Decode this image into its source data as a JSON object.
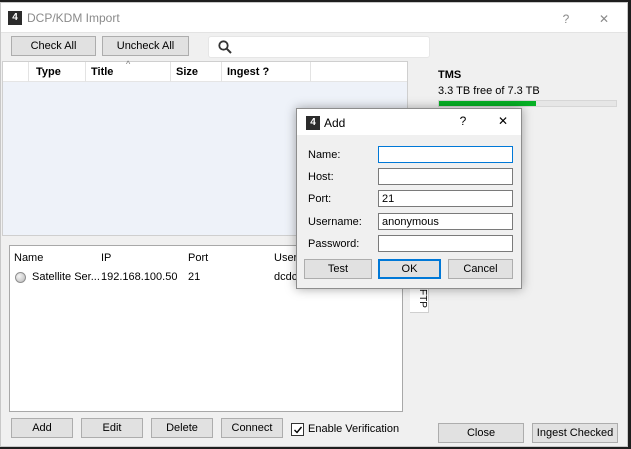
{
  "window": {
    "icon_text": "4",
    "title": "DCP/KDM Import",
    "help_glyph": "?",
    "close_glyph": "✕"
  },
  "toolbar": {
    "check_all": "Check All",
    "uncheck_all": "Uncheck All",
    "search_value": ""
  },
  "content_list": {
    "columns": [
      "Type",
      "Title",
      "Size",
      "Ingest ?"
    ],
    "sort_glyph": "^"
  },
  "servers": {
    "columns": [
      "Name",
      "IP",
      "Port",
      "User"
    ],
    "rows": [
      {
        "name": "Satellite Ser...",
        "ip": "192.168.100.50",
        "port": "21",
        "user": "dcdc"
      }
    ],
    "side_tab": "FTP"
  },
  "server_buttons": {
    "add": "Add",
    "edit": "Edit",
    "delete": "Delete",
    "connect": "Connect"
  },
  "enable_verification": {
    "label": "Enable Verification",
    "checked": true
  },
  "tms": {
    "title": "TMS",
    "free_text": "3.3 TB free of 7.3 TB",
    "used_fraction": 0.55,
    "fill_color": "#06b025"
  },
  "footer": {
    "close": "Close",
    "ingest_checked": "Ingest Checked"
  },
  "add_dialog": {
    "icon_text": "4",
    "title": "Add",
    "help_glyph": "?",
    "close_glyph": "✕",
    "fields": {
      "name": {
        "label": "Name:",
        "value": ""
      },
      "host": {
        "label": "Host:",
        "value": ""
      },
      "port": {
        "label": "Port:",
        "value": "21"
      },
      "username": {
        "label": "Username:",
        "value": "anonymous"
      },
      "password": {
        "label": "Password:",
        "value": ""
      }
    },
    "buttons": {
      "test": "Test",
      "ok": "OK",
      "cancel": "Cancel"
    }
  }
}
